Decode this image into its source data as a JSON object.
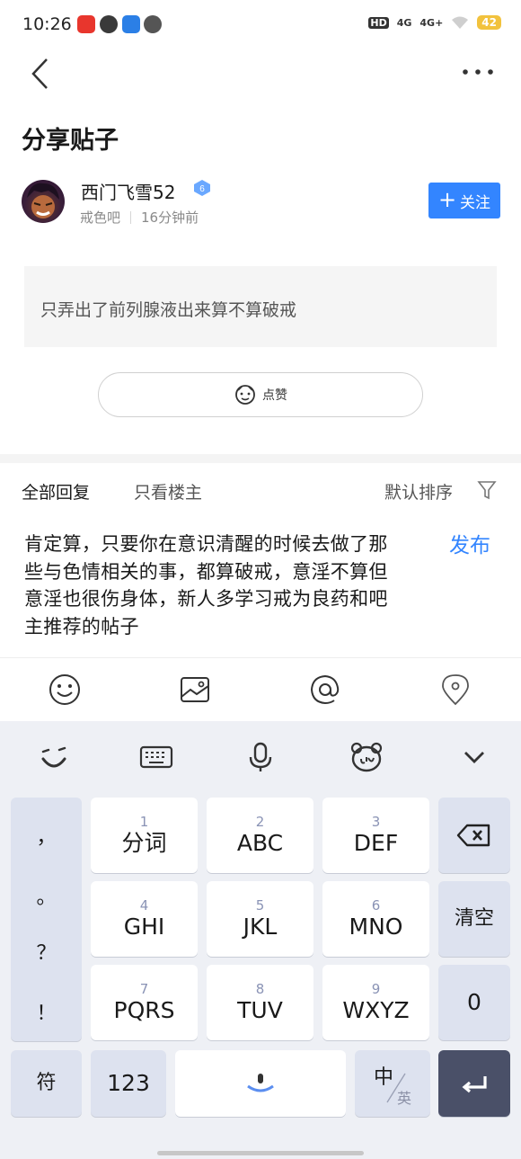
{
  "status_bar": {
    "time": "10:26",
    "hd_label": "HD",
    "signal_labels": [
      "4G",
      "4G+"
    ],
    "battery": "42"
  },
  "header": {
    "title": "分享贴子"
  },
  "author": {
    "name": "西门飞雪52",
    "level": "6",
    "forum": "戒色吧",
    "time_ago": "16分钟前",
    "follow_label": "关注"
  },
  "post": {
    "text": "只弄出了前列腺液出来算不算破戒"
  },
  "like": {
    "label": "点赞"
  },
  "replies": {
    "tab_all": "全部回复",
    "tab_owner": "只看楼主",
    "sort_label": "默认排序"
  },
  "composer": {
    "text": "肯定算，只要你在意识清醒的时候去做了那些与色情相关的事，都算破戒，意淫不算但意淫也很伤身体，新人多学习戒为良药和吧主推荐的帖子",
    "publish_label": "发布"
  },
  "keyboard": {
    "punctuation": [
      "，",
      "。",
      "？",
      "！"
    ],
    "keys": [
      {
        "num": "1",
        "label": "分词"
      },
      {
        "num": "2",
        "label": "ABC"
      },
      {
        "num": "3",
        "label": "DEF"
      },
      {
        "num": "4",
        "label": "GHI"
      },
      {
        "num": "5",
        "label": "JKL"
      },
      {
        "num": "6",
        "label": "MNO"
      },
      {
        "num": "7",
        "label": "PQRS"
      },
      {
        "num": "8",
        "label": "TUV"
      },
      {
        "num": "9",
        "label": "WXYZ"
      }
    ],
    "clear_label": "清空",
    "zero_label": "0",
    "symbol_label": "符",
    "num_label": "123",
    "lang_primary": "中",
    "lang_secondary": "英"
  }
}
